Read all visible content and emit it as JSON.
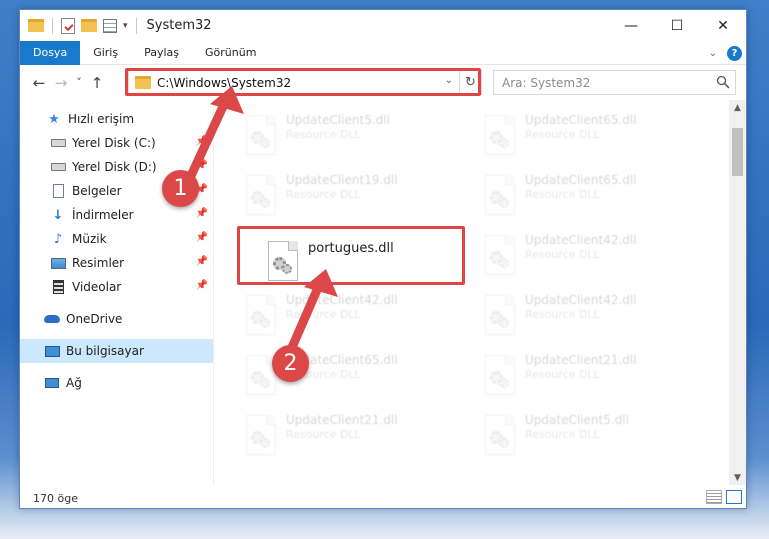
{
  "window": {
    "title": "System32",
    "controls": {
      "minimize": "—",
      "maximize": "☐",
      "close": "✕"
    }
  },
  "ribbon": {
    "tabs": [
      {
        "label": "Dosya",
        "active": true
      },
      {
        "label": "Giriş",
        "active": false
      },
      {
        "label": "Paylaş",
        "active": false
      },
      {
        "label": "Görünüm",
        "active": false
      }
    ],
    "expand_icon": "chevron-down-icon",
    "help_label": "?"
  },
  "navbar": {
    "back": "←",
    "forward": "→",
    "recent": "˅",
    "up": "↑",
    "address": "C:\\Windows\\System32",
    "search_placeholder": "Ara: System32"
  },
  "sidebar": {
    "items": [
      {
        "label": "Hızlı erişim",
        "icon": "star-icon",
        "pinned": false
      },
      {
        "label": "Yerel Disk (C:)",
        "icon": "drive-icon",
        "pinned": true
      },
      {
        "label": "Yerel Disk (D:)",
        "icon": "drive-icon",
        "pinned": true
      },
      {
        "label": "Belgeler",
        "icon": "documents-icon",
        "pinned": true
      },
      {
        "label": "İndirmeler",
        "icon": "downloads-icon",
        "pinned": true
      },
      {
        "label": "Müzik",
        "icon": "music-icon",
        "pinned": true
      },
      {
        "label": "Resimler",
        "icon": "pictures-icon",
        "pinned": true
      },
      {
        "label": "Videolar",
        "icon": "videos-icon",
        "pinned": true
      },
      {
        "label": "OneDrive",
        "icon": "cloud-icon",
        "pinned": false
      },
      {
        "label": "Bu bilgisayar",
        "icon": "computer-icon",
        "pinned": false,
        "selected": true
      },
      {
        "label": "Ağ",
        "icon": "network-icon",
        "pinned": false
      }
    ]
  },
  "files": {
    "highlighted": {
      "name": "portugues.dll"
    },
    "faded": [
      {
        "name": "UpdateClient5.dll",
        "type": "Resource DLL"
      },
      {
        "name": "UpdateClient65.dll",
        "type": "Resource DLL"
      },
      {
        "name": "UpdateClient19.dll",
        "type": "Resource DLL"
      },
      {
        "name": "UpdateClient65.dll",
        "type": "Resource DLL"
      },
      {
        "name": "UpdateClient42.dll",
        "type": "Resource DLL"
      },
      {
        "name": "UpdateClient42.dll",
        "type": "Resource DLL"
      },
      {
        "name": "UpdateClient42.dll",
        "type": "Resource DLL"
      },
      {
        "name": "UpdateClient65.dll",
        "type": "Resource DLL"
      },
      {
        "name": "UpdateClient21.dll",
        "type": "Resource DLL"
      },
      {
        "name": "UpdateClient21.dll",
        "type": "Resource DLL"
      },
      {
        "name": "UpdateClient5.dll",
        "type": "Resource DLL"
      }
    ]
  },
  "status": {
    "item_count": "170 öge"
  },
  "annotations": {
    "step1": "1",
    "step2": "2",
    "color": "#dc4848"
  }
}
